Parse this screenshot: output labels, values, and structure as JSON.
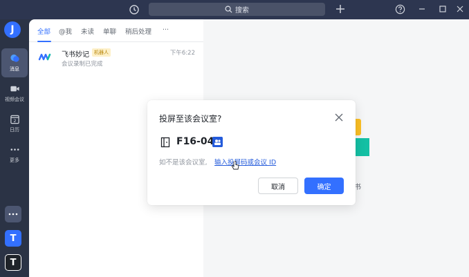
{
  "topbar": {
    "search_placeholder": "搜索"
  },
  "user": {
    "avatar_letter": "J"
  },
  "nav": {
    "items": [
      {
        "label": "消息",
        "icon": "chat-bubble-icon"
      },
      {
        "label": "视频会议",
        "icon": "video-camera-icon"
      },
      {
        "label": "日历",
        "icon": "calendar-icon"
      },
      {
        "label": "更多",
        "icon": "more-dots-icon"
      }
    ],
    "calendar_day": "2",
    "apps": [
      {
        "letter": "T",
        "color": "#3370ff"
      },
      {
        "letter": "T",
        "color": "#1f2329"
      }
    ]
  },
  "chat_tabs": [
    "全部",
    "@我",
    "未读",
    "单聊",
    "稍后处理",
    "···"
  ],
  "chats": [
    {
      "name": "飞书妙记",
      "badge": "机器人",
      "time": "下午6:22",
      "preview": "会议录制已完成"
    }
  ],
  "main": {
    "illustration_label": "书"
  },
  "dialog": {
    "title": "投屏至该会议室?",
    "room_name": "F16-04",
    "hint": "如不是该会议室,",
    "link": "输入投屏码或会议 ID",
    "cancel_label": "取消",
    "confirm_label": "确定"
  },
  "colors": {
    "accent": "#3370ff",
    "sidebar_bg": "#2b3345",
    "badge_bg": "#fdf0c8"
  }
}
